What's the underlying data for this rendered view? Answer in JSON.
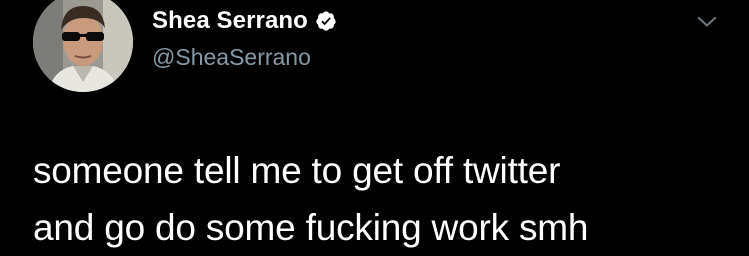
{
  "tweet": {
    "author": {
      "display_name": "Shea Serrano",
      "handle": "@SheaSerrano",
      "verified": true
    },
    "text_lines": [
      "someone tell me to get off twitter",
      "and go do some fucking work smh"
    ]
  },
  "icons": {
    "verified": "verified-badge-icon",
    "menu": "chevron-down-icon"
  },
  "colors": {
    "background": "#000000",
    "primary_text": "#ffffff",
    "secondary_text": "#8899a6",
    "chevron": "#6e767d"
  }
}
